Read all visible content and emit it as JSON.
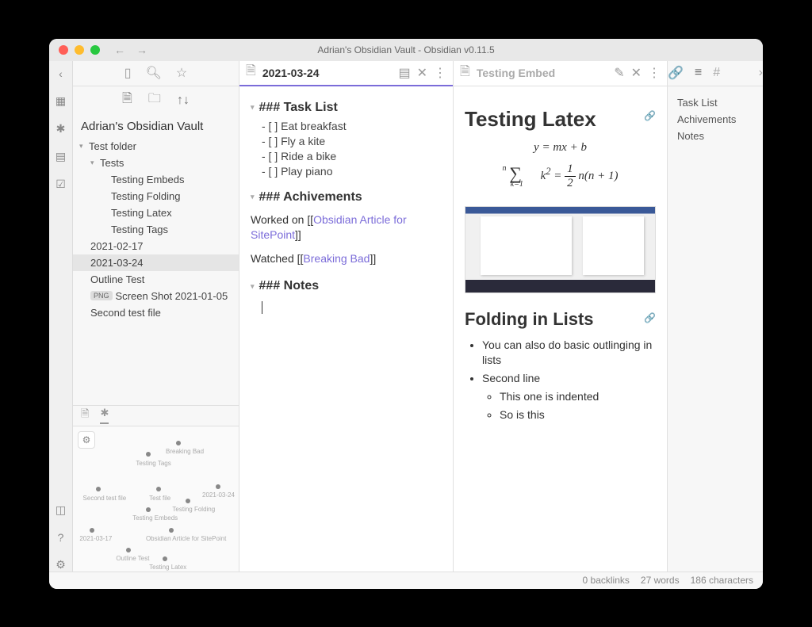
{
  "window": {
    "title": "Adrian's Obsidian Vault - Obsidian v0.11.5"
  },
  "vault": {
    "name": "Adrian's Obsidian Vault"
  },
  "tree": {
    "folder1": "Test folder",
    "folder2": "Tests",
    "files": [
      "Testing Embeds",
      "Testing Folding",
      "Testing Latex",
      "Testing Tags"
    ],
    "root": [
      "2021-02-17",
      "2021-03-24",
      "Outline Test"
    ],
    "png": "Screen Shot 2021-01-05",
    "png_badge": "PNG",
    "second": "Second test file"
  },
  "graph": {
    "labels": [
      "Breaking Bad",
      "Testing Tags",
      "Second test file",
      "Test file",
      "2021-03-24",
      "Testing Folding",
      "Testing Embeds",
      "2021-03-17",
      "Obsidian Article for SitePoint",
      "Outline Test",
      "Testing Latex"
    ]
  },
  "editor": {
    "title": "2021-03-24",
    "h_task": "### Task List",
    "tasks": [
      "- [ ] Eat breakfast",
      "- [ ] Fly a kite",
      "- [ ] Ride a bike",
      "- [ ] Play piano"
    ],
    "h_ach": "### Achivements",
    "ach_pre": "Worked on [[",
    "ach_link": "Obsidian Article for SitePoint",
    "ach_post": "]]",
    "watch_pre": "Watched [[",
    "watch_link": "Breaking Bad",
    "watch_post": "]]",
    "h_notes": "### Notes"
  },
  "preview": {
    "title": "Testing Embed",
    "h1": "Testing Latex",
    "eq1": "y = mx + b",
    "h2": "Folding in Lists",
    "li1": "You can also do basic outlinging in lists",
    "li2": "Second line",
    "li2a": "This one is indented",
    "li2b": "So is this"
  },
  "outline": {
    "items": [
      "Task List",
      "Achivements",
      "Notes"
    ]
  },
  "status": {
    "backlinks": "0 backlinks",
    "words": "27 words",
    "chars": "186 characters"
  }
}
